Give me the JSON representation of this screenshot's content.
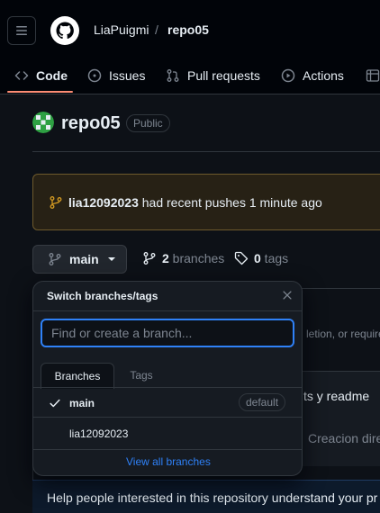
{
  "header": {
    "owner": "LiaPuigmi",
    "separator": "/",
    "repo": "repo05"
  },
  "tabs": [
    {
      "label": "Code",
      "icon": "code-icon",
      "active": true
    },
    {
      "label": "Issues",
      "icon": "issue-icon",
      "active": false
    },
    {
      "label": "Pull requests",
      "icon": "pull-request-icon",
      "active": false
    },
    {
      "label": "Actions",
      "icon": "play-icon",
      "active": false
    }
  ],
  "repo": {
    "name": "repo05",
    "visibility": "Public"
  },
  "push_banner": {
    "branch": "lia12092023",
    "message": " had recent pushes 1 minute ago"
  },
  "branch_bar": {
    "current_branch": "main",
    "branch_count": "2",
    "branch_label": " branches",
    "tag_count": "0",
    "tag_label": " tags"
  },
  "background": {
    "desc_fragment": "letion, or require",
    "commit_fragment": "ts y readme",
    "file_fragment": "Creacion dire",
    "help_text": "Help people interested in this repository understand your pr"
  },
  "dropdown": {
    "title": "Switch branches/tags",
    "search_placeholder": "Find or create a branch...",
    "tab_branches": "Branches",
    "tab_tags": "Tags",
    "branches": [
      {
        "name": "main",
        "selected": true,
        "badge": "default"
      },
      {
        "name": "lia12092023",
        "selected": false,
        "badge": ""
      }
    ],
    "view_all": "View all branches"
  },
  "colors": {
    "bg": "#0d1117",
    "header_bg": "#010409",
    "accent_underline": "#fd8c73",
    "link": "#2f81f7",
    "banner_bg": "#272115",
    "banner_icon": "#d29922"
  }
}
